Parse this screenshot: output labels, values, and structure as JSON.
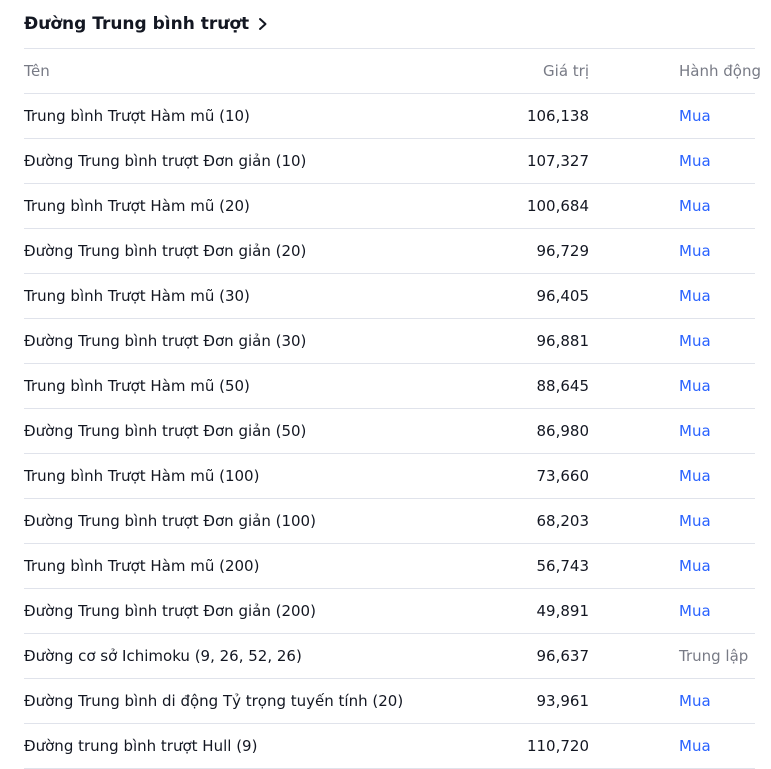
{
  "section": {
    "title": "Đường Trung bình trượt",
    "icon": "chevron-right-icon"
  },
  "columns": {
    "name": "Tên",
    "value": "Giá trị",
    "action": "Hành động"
  },
  "colors": {
    "buy": "#2962ff",
    "neutral": "#787b86",
    "text": "#131722",
    "divider": "#e0e3eb"
  },
  "rows": [
    {
      "name": "Trung bình Trượt Hàm mũ (10)",
      "value": "106,138",
      "action": "Mua",
      "kind": "buy"
    },
    {
      "name": "Đường Trung bình trượt Đơn giản (10)",
      "value": "107,327",
      "action": "Mua",
      "kind": "buy"
    },
    {
      "name": "Trung bình Trượt Hàm mũ (20)",
      "value": "100,684",
      "action": "Mua",
      "kind": "buy"
    },
    {
      "name": "Đường Trung bình trượt Đơn giản (20)",
      "value": "96,729",
      "action": "Mua",
      "kind": "buy"
    },
    {
      "name": "Trung bình Trượt Hàm mũ (30)",
      "value": "96,405",
      "action": "Mua",
      "kind": "buy"
    },
    {
      "name": "Đường Trung bình trượt Đơn giản (30)",
      "value": "96,881",
      "action": "Mua",
      "kind": "buy"
    },
    {
      "name": "Trung bình Trượt Hàm mũ (50)",
      "value": "88,645",
      "action": "Mua",
      "kind": "buy"
    },
    {
      "name": "Đường Trung bình trượt Đơn giản (50)",
      "value": "86,980",
      "action": "Mua",
      "kind": "buy"
    },
    {
      "name": "Trung bình Trượt Hàm mũ (100)",
      "value": "73,660",
      "action": "Mua",
      "kind": "buy"
    },
    {
      "name": "Đường Trung bình trượt Đơn giản (100)",
      "value": "68,203",
      "action": "Mua",
      "kind": "buy"
    },
    {
      "name": "Trung bình Trượt Hàm mũ (200)",
      "value": "56,743",
      "action": "Mua",
      "kind": "buy"
    },
    {
      "name": "Đường Trung bình trượt Đơn giản (200)",
      "value": "49,891",
      "action": "Mua",
      "kind": "buy"
    },
    {
      "name": "Đường cơ sở Ichimoku (9, 26, 52, 26)",
      "value": "96,637",
      "action": "Trung lập",
      "kind": "neutral"
    },
    {
      "name": "Đường Trung bình di động Tỷ trọng tuyến tính (20)",
      "value": "93,961",
      "action": "Mua",
      "kind": "buy"
    },
    {
      "name": "Đường trung bình trượt Hull (9)",
      "value": "110,720",
      "action": "Mua",
      "kind": "buy"
    }
  ]
}
